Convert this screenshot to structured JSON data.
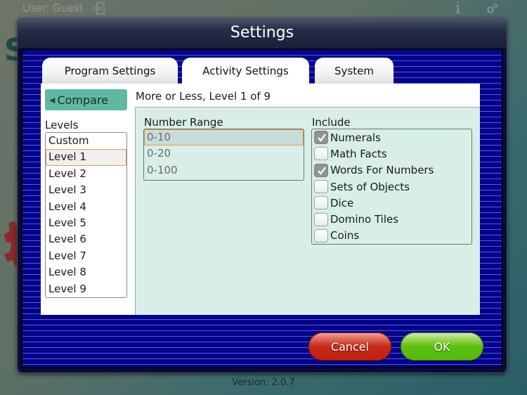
{
  "topbar": {
    "user_label": "User: Guest",
    "info_icon": "i"
  },
  "dialog": {
    "title": "Settings",
    "tabs": [
      {
        "label": "Program Settings",
        "active": false
      },
      {
        "label": "Activity Settings",
        "active": true
      },
      {
        "label": "System",
        "active": false
      }
    ],
    "compare_button": {
      "label": "Compare",
      "icon": "triangle-left"
    },
    "activity_title": "More or Less, Level 1 of 9",
    "levels": {
      "label": "Levels",
      "items": [
        "Custom",
        "Level 1",
        "Level 2",
        "Level 3",
        "Level 4",
        "Level 5",
        "Level 6",
        "Level 7",
        "Level 8",
        "Level 9"
      ],
      "selected": "Level 1"
    },
    "number_range": {
      "label": "Number Range",
      "items": [
        "0-10",
        "0-20",
        "0-100"
      ],
      "selected": "0-10"
    },
    "include": {
      "label": "Include",
      "items": [
        {
          "label": "Numerals",
          "checked": true
        },
        {
          "label": "Math Facts",
          "checked": false
        },
        {
          "label": "Words For Numbers",
          "checked": true
        },
        {
          "label": "Sets of Objects",
          "checked": false
        },
        {
          "label": "Dice",
          "checked": false
        },
        {
          "label": "Domino Tiles",
          "checked": false
        },
        {
          "label": "Coins",
          "checked": false
        }
      ]
    },
    "buttons": {
      "cancel": "Cancel",
      "ok": "OK"
    }
  },
  "version": "Version: 2.0.7",
  "colors": {
    "dialog_body": "#03038c",
    "compare_button": "#5fb8a2",
    "settings_area": "#d8eee9",
    "selection_border": "#e39a4a",
    "cancel_button": "#c62a18",
    "ok_button": "#5cc010"
  }
}
